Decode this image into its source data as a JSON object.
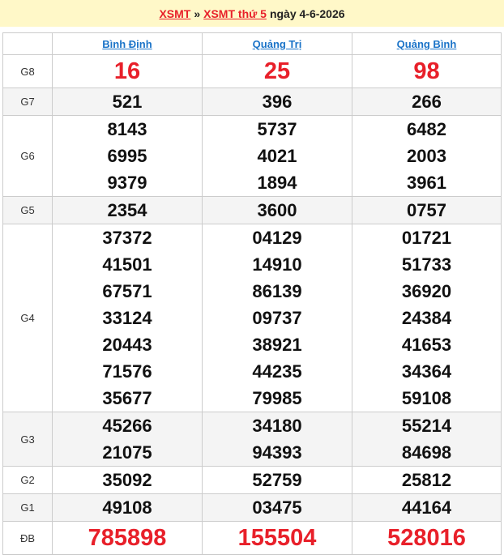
{
  "header": {
    "crumb1": "XSMT",
    "separator": "»",
    "crumb2": "XSMT thứ 5",
    "date_text": "ngày 4-6-2026"
  },
  "provinces": [
    "Bình Định",
    "Quảng Trị",
    "Quảng Bình"
  ],
  "prizes": {
    "g8": {
      "label": "G8",
      "values": [
        [
          "16"
        ],
        [
          "25"
        ],
        [
          "98"
        ]
      ]
    },
    "g7": {
      "label": "G7",
      "values": [
        [
          "521"
        ],
        [
          "396"
        ],
        [
          "266"
        ]
      ]
    },
    "g6": {
      "label": "G6",
      "values": [
        [
          "8143",
          "6995",
          "9379"
        ],
        [
          "5737",
          "4021",
          "1894"
        ],
        [
          "6482",
          "2003",
          "3961"
        ]
      ]
    },
    "g5": {
      "label": "G5",
      "values": [
        [
          "2354"
        ],
        [
          "3600"
        ],
        [
          "0757"
        ]
      ]
    },
    "g4": {
      "label": "G4",
      "values": [
        [
          "37372",
          "41501",
          "67571",
          "33124",
          "20443",
          "71576",
          "35677"
        ],
        [
          "04129",
          "14910",
          "86139",
          "09737",
          "38921",
          "44235",
          "79985"
        ],
        [
          "01721",
          "51733",
          "36920",
          "24384",
          "41653",
          "34364",
          "59108"
        ]
      ]
    },
    "g3": {
      "label": "G3",
      "values": [
        [
          "45266",
          "21075"
        ],
        [
          "34180",
          "94393"
        ],
        [
          "55214",
          "84698"
        ]
      ]
    },
    "g2": {
      "label": "G2",
      "values": [
        [
          "35092"
        ],
        [
          "52759"
        ],
        [
          "25812"
        ]
      ]
    },
    "g1": {
      "label": "G1",
      "values": [
        [
          "49108"
        ],
        [
          "03475"
        ],
        [
          "44164"
        ]
      ]
    },
    "db": {
      "label": "ĐB",
      "values": [
        [
          "785898"
        ],
        [
          "155504"
        ],
        [
          "528016"
        ]
      ]
    }
  },
  "colors": {
    "accent_red": "#e8202a",
    "link_blue": "#1a73c8",
    "header_bg": "#fff8c8",
    "alt_row": "#f4f4f4"
  }
}
